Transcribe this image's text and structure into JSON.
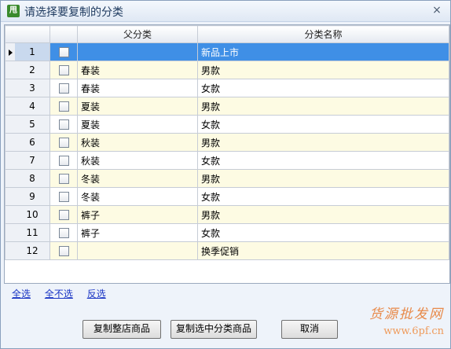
{
  "window": {
    "title": "请选择要复制的分类",
    "app_icon_text": "甩",
    "close_glyph": "×"
  },
  "grid": {
    "columns": [
      "父分类",
      "分类名称"
    ],
    "rows": [
      {
        "num": "1",
        "parent": "",
        "name": "新品上市",
        "selected": true
      },
      {
        "num": "2",
        "parent": "春装",
        "name": "男款"
      },
      {
        "num": "3",
        "parent": "春装",
        "name": "女款"
      },
      {
        "num": "4",
        "parent": "夏装",
        "name": "男款"
      },
      {
        "num": "5",
        "parent": "夏装",
        "name": "女款"
      },
      {
        "num": "6",
        "parent": "秋装",
        "name": "男款"
      },
      {
        "num": "7",
        "parent": "秋装",
        "name": "女款"
      },
      {
        "num": "8",
        "parent": "冬装",
        "name": "男款"
      },
      {
        "num": "9",
        "parent": "冬装",
        "name": "女款"
      },
      {
        "num": "10",
        "parent": "裤子",
        "name": "男款"
      },
      {
        "num": "11",
        "parent": "裤子",
        "name": "女款"
      },
      {
        "num": "12",
        "parent": "",
        "name": "换季促销"
      }
    ]
  },
  "links": {
    "select_all": "全选",
    "select_none": "全不选",
    "invert": "反选"
  },
  "buttons": {
    "copy_store": "复制整店商品",
    "copy_selected": "复制选中分类商品",
    "cancel": "取消"
  },
  "watermark": {
    "line1": "货源批发网",
    "line2": "www.6pf.cn"
  },
  "colors": {
    "selected_row": "#3f8fe6",
    "alt_row": "#fdfbe3",
    "link": "#1a35c4"
  }
}
